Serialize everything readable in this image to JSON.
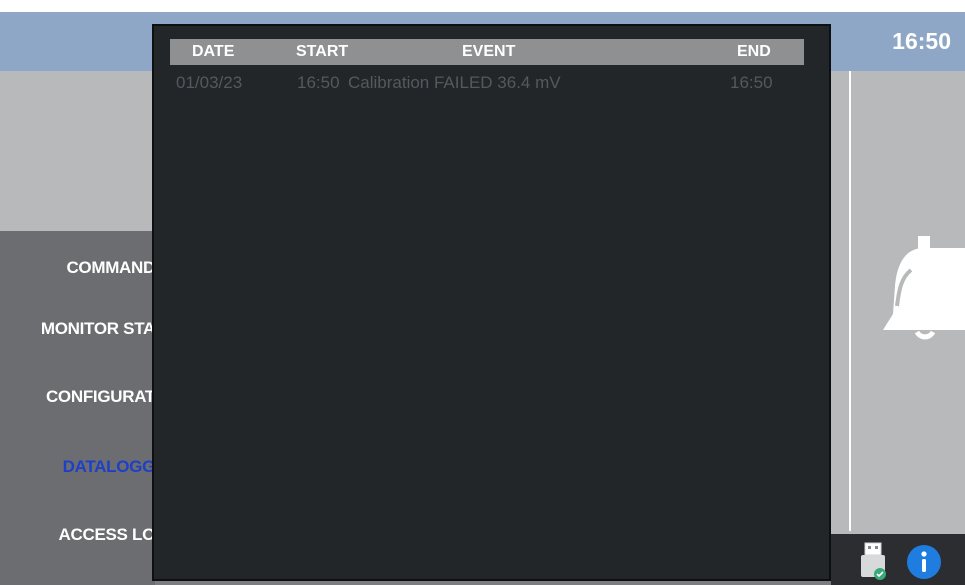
{
  "header": {
    "clock": "16:50"
  },
  "menu": {
    "items": [
      {
        "label": "COMMAND"
      },
      {
        "label": "MONITOR STA"
      },
      {
        "label": "CONFIGURAT"
      },
      {
        "label": "DATALOGG"
      },
      {
        "label": "ACCESS LO"
      }
    ],
    "active_color": "#1e3fc8"
  },
  "log": {
    "columns": {
      "date": "DATE",
      "start": "START",
      "event": "EVENT",
      "end": "END"
    },
    "rows": [
      {
        "date": "01/03/23",
        "start": "16:50",
        "event": "Calibration FAILED  36.4 mV",
        "end": "16:50"
      }
    ]
  },
  "icons": {
    "alarm": "bell-icon",
    "usb": "usb-drive-icon",
    "info": "info-icon"
  },
  "colors": {
    "topbar": "#8fa7c6",
    "modal_bg": "#232629",
    "menu_bg": "#6b6d70"
  }
}
